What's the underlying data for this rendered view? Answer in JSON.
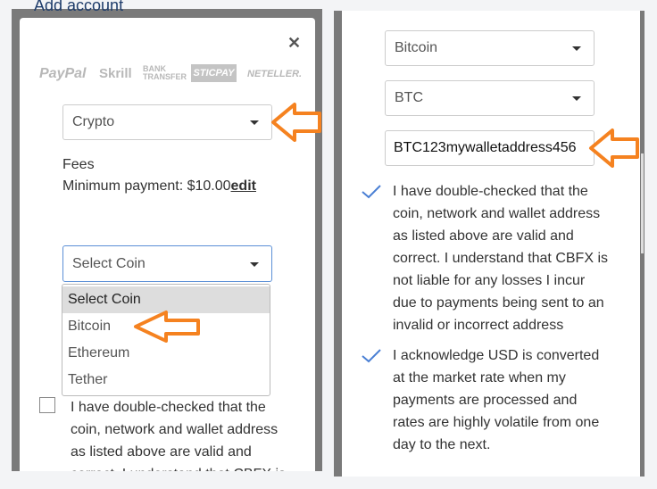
{
  "left": {
    "header_text": "Add account",
    "close_icon": "close-icon",
    "payment_logos": [
      "PayPal",
      "Skrill",
      "BANK TRANSFER",
      "STICPAY",
      "NETELLER."
    ],
    "method_select": "Crypto",
    "fees_label": "Fees",
    "min_payment_label": "Minimum payment: $10.00",
    "edit_link": "edit",
    "coin_select": "Select Coin",
    "coin_options": [
      "Select Coin",
      "Bitcoin",
      "Ethereum",
      "Tether"
    ],
    "checkbox_checked": false,
    "disclaimer_lines": [
      "I have double-checked that the",
      "coin, network and wallet address",
      "as listed above are valid and",
      "correct. I understand that CBFX is"
    ]
  },
  "right": {
    "coin_select": "Bitcoin",
    "network_select": "BTC",
    "wallet_address": "BTC123mywalletaddress456",
    "check1_lines": [
      "I have double-checked that the",
      "coin, network and wallet address",
      "as listed above are valid and",
      "correct. I understand that CBFX is",
      "not liable for any losses I incur",
      "due to payments being sent to an",
      "invalid or incorrect address"
    ],
    "check2_lines": [
      "I acknowledge USD is converted",
      "at the market rate when my",
      "payments are processed and",
      "rates are highly volatile from one",
      "day to the next."
    ]
  },
  "colors": {
    "annotation_arrow": "#f58220",
    "check": "#4a7fd4",
    "focus_border": "#5b8fd6"
  }
}
